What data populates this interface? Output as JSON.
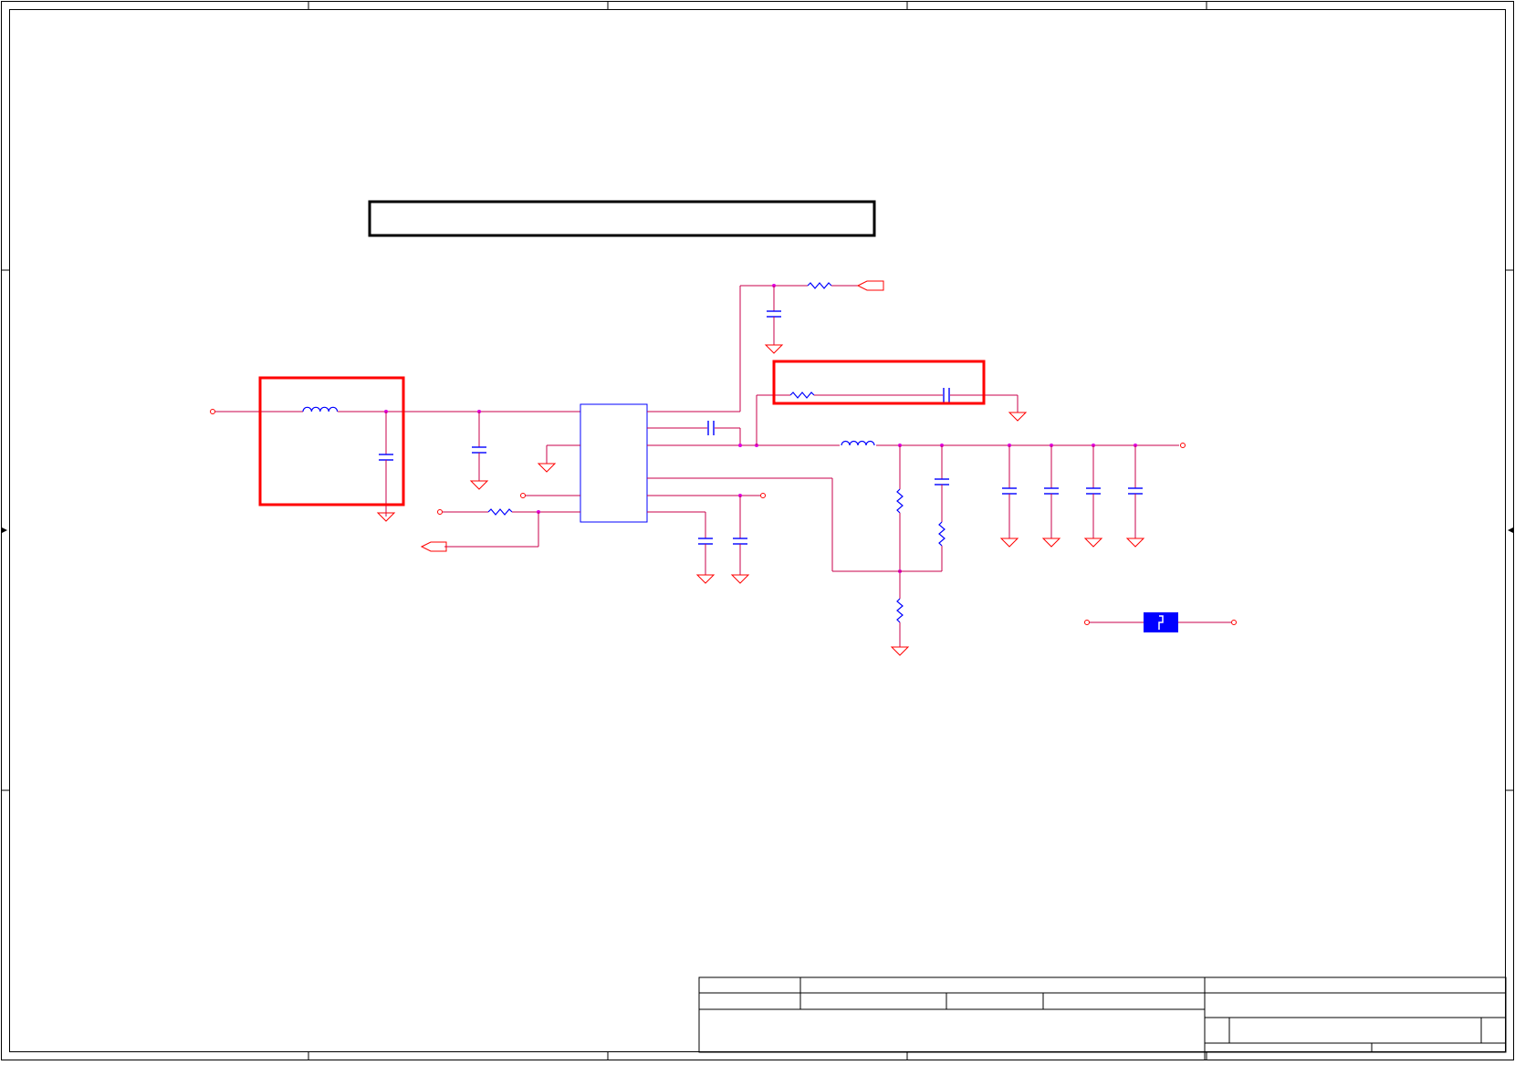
{
  "title_block": {
    "title": "",
    "size": "",
    "document_number": "",
    "rev": "",
    "date": "",
    "sheet": ""
  },
  "notes": {
    "header_note": ""
  },
  "colors": {
    "wire": "#c8004b",
    "component": "#0000ff",
    "junction": "#e000e0",
    "ground": "#ff0000",
    "highlight": "#ff0000",
    "border": "#000000"
  },
  "components": [
    "inductor-icon",
    "capacitor-icon",
    "resistor-icon",
    "ground-icon",
    "ic-package",
    "jumper-pad-icon",
    "net-port-icon"
  ]
}
